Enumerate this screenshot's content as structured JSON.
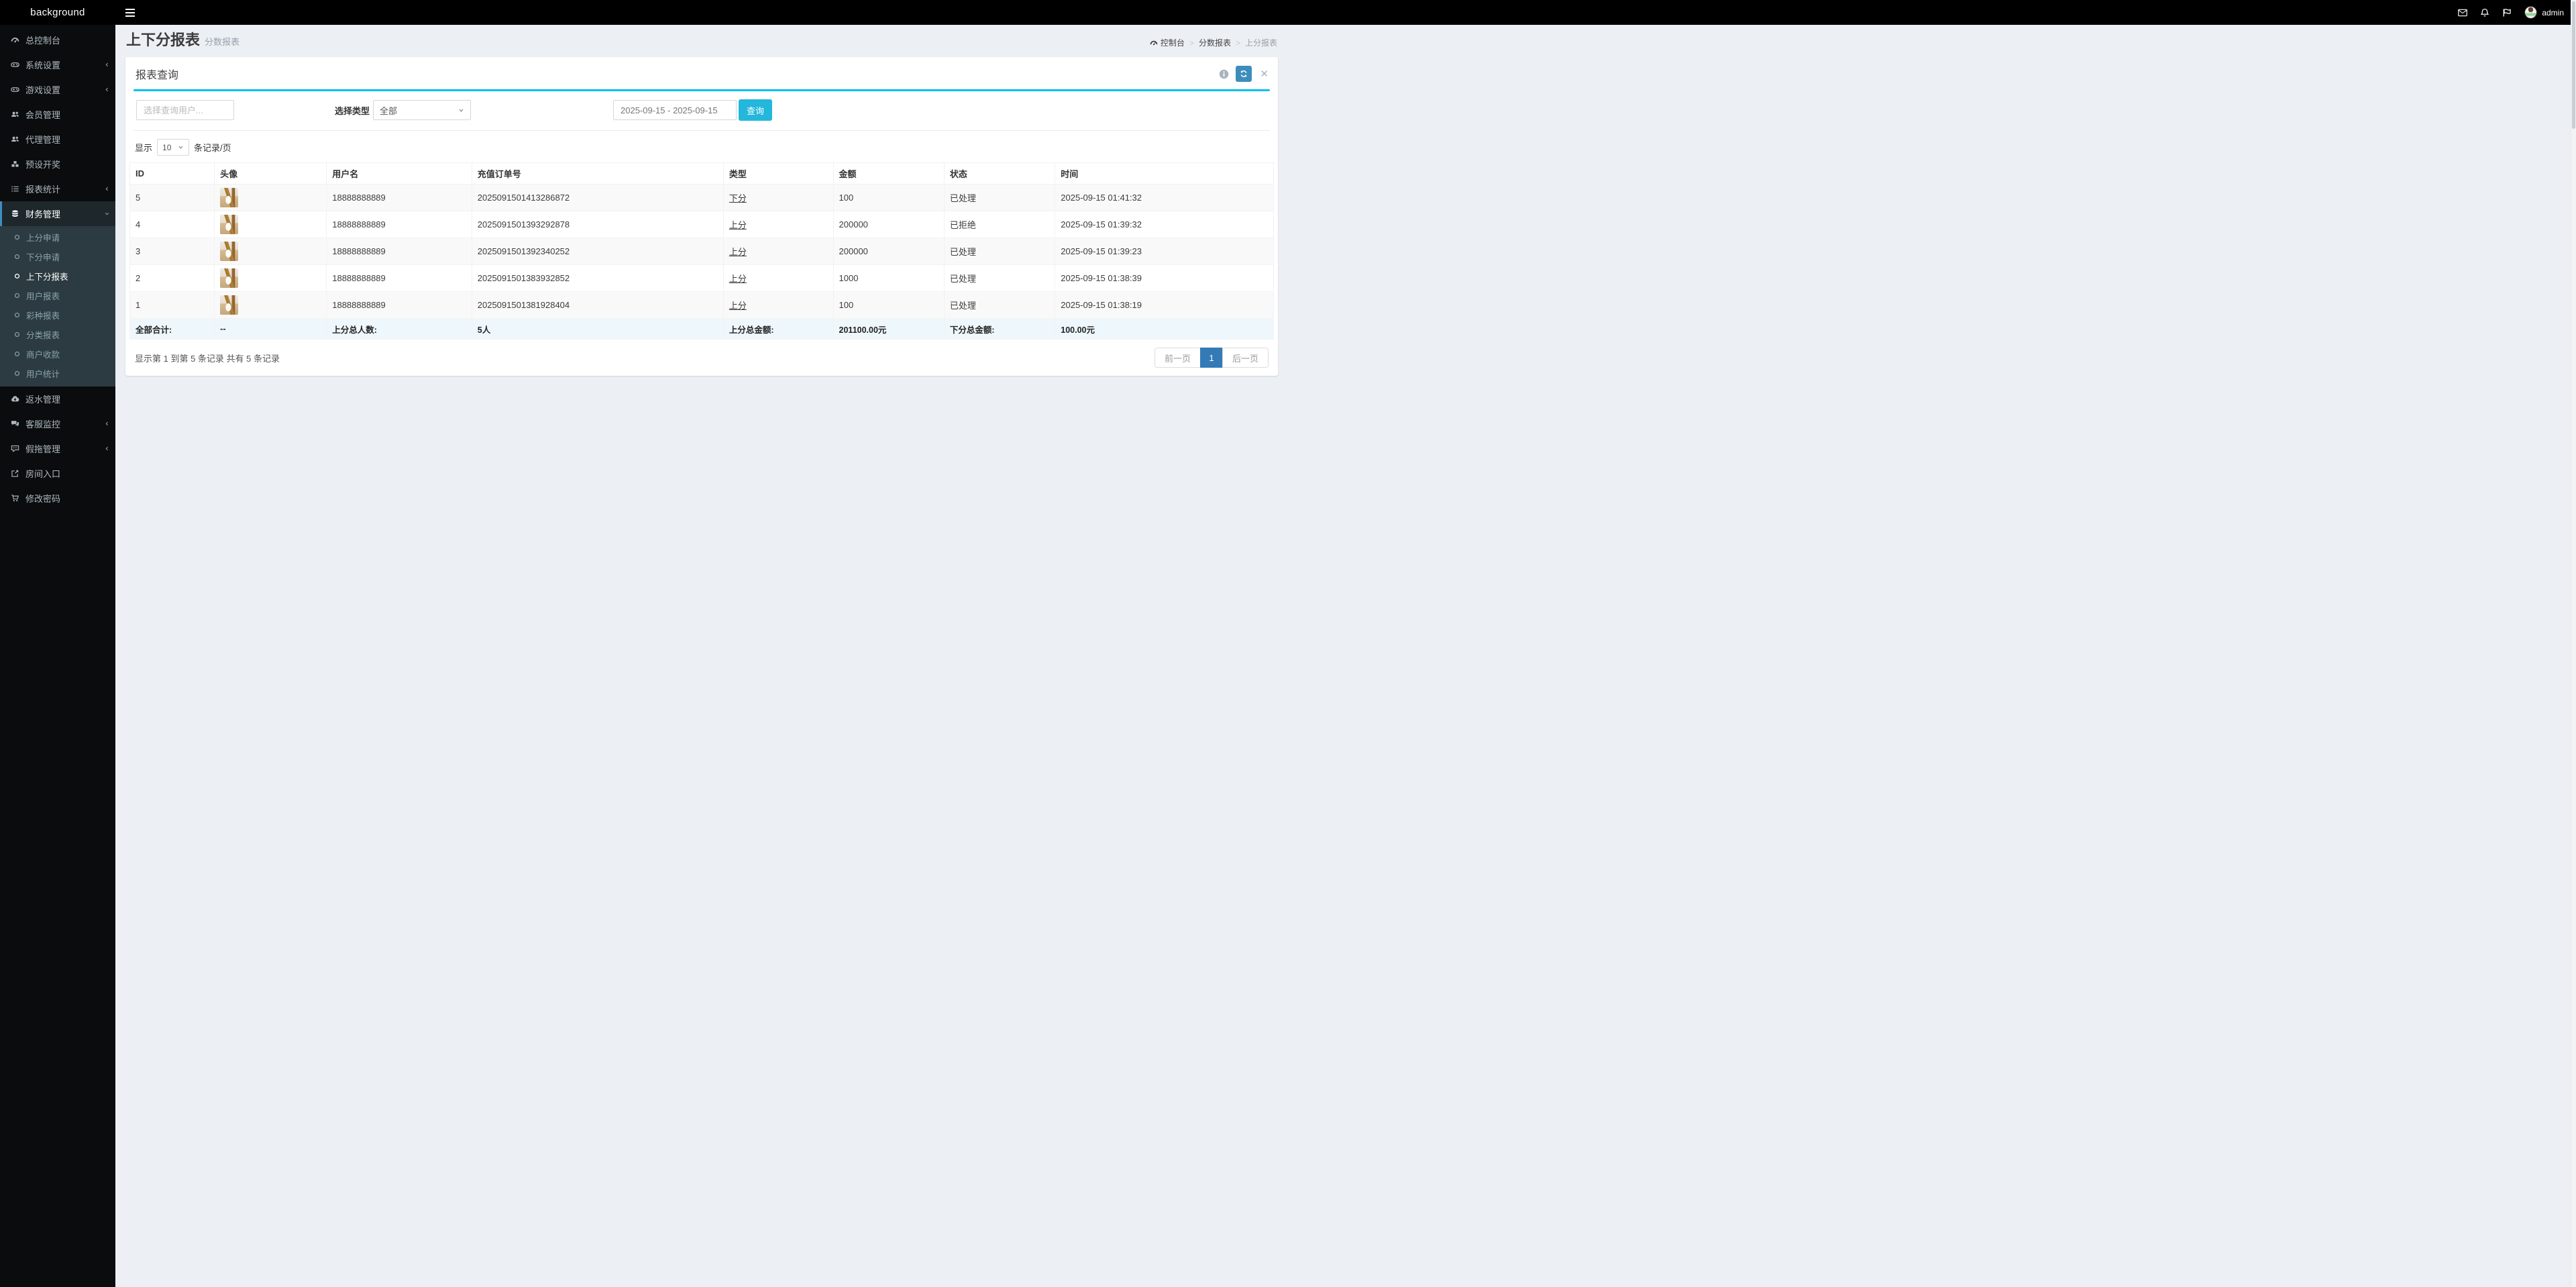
{
  "app": {
    "logo": "background"
  },
  "navbar": {
    "username": "admin",
    "icons": [
      "hamburger-icon",
      "envelope-icon",
      "bell-icon",
      "flag-icon",
      "avatar"
    ]
  },
  "sidebar": {
    "items": [
      {
        "label": "总控制台",
        "icon": "gauge-icon"
      },
      {
        "label": "系统设置",
        "icon": "gamepad-icon",
        "chevron": "left"
      },
      {
        "label": "游戏设置",
        "icon": "gamepad-icon",
        "chevron": "left"
      },
      {
        "label": "会员管理",
        "icon": "users-icon"
      },
      {
        "label": "代理管理",
        "icon": "users-icon"
      },
      {
        "label": "预设开奖",
        "icon": "cubes-icon"
      },
      {
        "label": "报表统计",
        "icon": "list-icon",
        "chevron": "left"
      },
      {
        "label": "财务管理",
        "icon": "database-icon",
        "chevron": "down",
        "active": true,
        "children": [
          {
            "label": "上分申请"
          },
          {
            "label": "下分申请"
          },
          {
            "label": "上下分报表",
            "active": true
          },
          {
            "label": "用户报表"
          },
          {
            "label": "彩种报表"
          },
          {
            "label": "分类报表"
          },
          {
            "label": "商户收款"
          },
          {
            "label": "用户统计"
          }
        ]
      },
      {
        "label": "返水管理",
        "icon": "cloud-download-icon"
      },
      {
        "label": "客服监控",
        "icon": "comments-icon",
        "chevron": "left"
      },
      {
        "label": "假拖管理",
        "icon": "comment-dots-icon",
        "chevron": "left"
      },
      {
        "label": "房间入口",
        "icon": "share-icon"
      },
      {
        "label": "修改密码",
        "icon": "cart-icon"
      }
    ]
  },
  "page": {
    "title": "上下分报表",
    "subtitle": "分数报表",
    "breadcrumb": [
      "控制台",
      "分数报表",
      "上分报表"
    ]
  },
  "panel": {
    "title": "报表查询",
    "tools": [
      "info-icon",
      "refresh-icon",
      "close-icon"
    ]
  },
  "filters": {
    "user_placeholder": "选择查询用户...",
    "type_label": "选择类型",
    "type_value": "全部",
    "date_value": "2025-09-15 - 2025-09-15",
    "search_label": "查询"
  },
  "table": {
    "page_size": {
      "prefix": "显示",
      "value": "10",
      "suffix": "条记录/页"
    },
    "columns": [
      "ID",
      "头像",
      "用户名",
      "充值订单号",
      "类型",
      "金额",
      "状态",
      "时间"
    ],
    "rows": [
      {
        "id": "5",
        "avatar": "bunny-photo",
        "username": "18888888889",
        "order": "2025091501413286872",
        "type": "下分",
        "amount": "100",
        "status": "已处理",
        "time": "2025-09-15 01:41:32"
      },
      {
        "id": "4",
        "avatar": "bunny-photo",
        "username": "18888888889",
        "order": "2025091501393292878",
        "type": "上分",
        "amount": "200000",
        "status": "已拒绝",
        "time": "2025-09-15 01:39:32"
      },
      {
        "id": "3",
        "avatar": "bunny-photo",
        "username": "18888888889",
        "order": "2025091501392340252",
        "type": "上分",
        "amount": "200000",
        "status": "已处理",
        "time": "2025-09-15 01:39:23"
      },
      {
        "id": "2",
        "avatar": "bunny-photo",
        "username": "18888888889",
        "order": "2025091501383932852",
        "type": "上分",
        "amount": "1000",
        "status": "已处理",
        "time": "2025-09-15 01:38:39"
      },
      {
        "id": "1",
        "avatar": "bunny-photo",
        "username": "18888888889",
        "order": "2025091501381928404",
        "type": "上分",
        "amount": "100",
        "status": "已处理",
        "time": "2025-09-15 01:38:19"
      }
    ],
    "summary": [
      "全部合计:",
      "--",
      "上分总人数:",
      "5人",
      "上分总金额:",
      "201100.00元",
      "下分总金额:",
      "100.00元"
    ]
  },
  "pagination": {
    "info": "显示第 1 到第 5 条记录 共有 5 条记录",
    "prev": "前一页",
    "current": "1",
    "next": "后一页"
  },
  "colors": {
    "accent_cyan": "#00c0ef",
    "search_button": "#23b7dc",
    "primary_blue": "#3c8dbc",
    "pager_active": "#337ab7",
    "sidebar_bg": "#0a0c0d",
    "submenu_bg": "#2c3b41",
    "summary_row_bg": "#eef7fb",
    "content_bg": "#ecf0f5"
  }
}
